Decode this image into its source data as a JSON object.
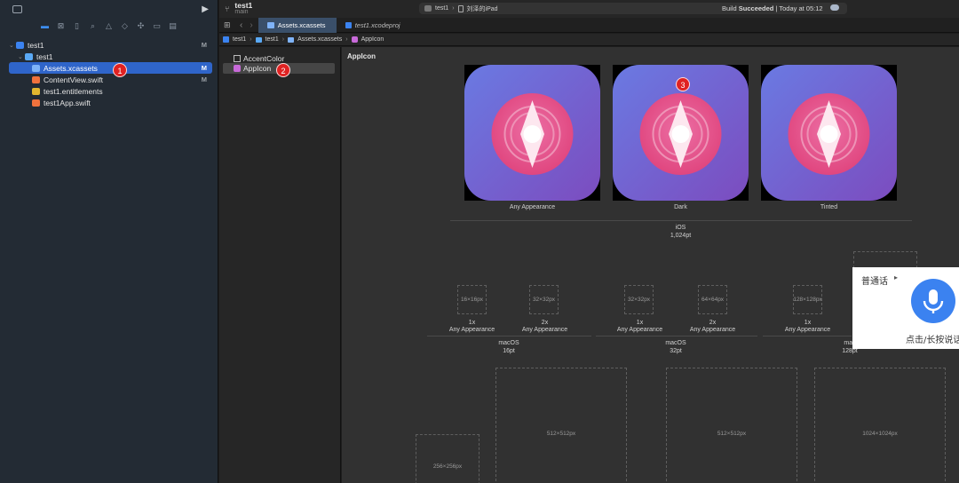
{
  "navigator": {
    "items": [
      {
        "label": "test1",
        "badge": "M"
      },
      {
        "label": "test1",
        "badge": ""
      },
      {
        "label": "Assets.xcassets",
        "badge": "M"
      },
      {
        "label": "ContentView.swift",
        "badge": "M"
      },
      {
        "label": "test1.entitlements",
        "badge": ""
      },
      {
        "label": "test1App.swift",
        "badge": ""
      }
    ]
  },
  "markers": [
    "1",
    "2",
    "3"
  ],
  "toolbar": {
    "scheme_name": "test1",
    "branch": "main",
    "destination_project": "test1",
    "destination_device": "刘泽的iPad",
    "build_prefix": "Build ",
    "build_status": "Succeeded",
    "build_time": " | Today at 05:12"
  },
  "tabs": [
    {
      "label": "Assets.xcassets"
    },
    {
      "label": "test1.xcodeproj"
    }
  ],
  "jumpbar": [
    "test1",
    "test1",
    "Assets.xcassets",
    "AppIcon"
  ],
  "assets": [
    {
      "label": "AccentColor"
    },
    {
      "label": "AppIcon"
    }
  ],
  "canvas": {
    "title": "AppIcon",
    "ios_appearances": [
      "Any Appearance",
      "Dark",
      "Tinted"
    ],
    "ios_group": {
      "platform": "iOS",
      "size": "1,024pt"
    },
    "mac_slots": [
      "16×16px",
      "32×32px",
      "32×32px",
      "64×64px",
      "128×128px"
    ],
    "mac_scales": [
      {
        "scale": "1x",
        "appearance": "Any Appearance"
      },
      {
        "scale": "2x",
        "appearance": "Any Appearance"
      },
      {
        "scale": "1x",
        "appearance": "Any Appearance"
      },
      {
        "scale": "2x",
        "appearance": "Any Appearance"
      },
      {
        "scale": "1x",
        "appearance": "Any Appearance"
      }
    ],
    "mac_groups": [
      {
        "platform": "macOS",
        "size": "16pt"
      },
      {
        "platform": "macOS",
        "size": "32pt"
      },
      {
        "platform": "mac",
        "size": "128pt"
      }
    ],
    "large_slots": [
      "256×256px",
      "512×512px",
      "512×512px",
      "1024×1024px"
    ]
  },
  "voice_popup": {
    "label": "普通话",
    "hint": "点击/长按说话"
  },
  "colors": {
    "selection": "#2f65ca",
    "icon_bg_top": "#6a79e0",
    "icon_bg_bottom": "#7a4fc0",
    "icon_circle": "#e8508c",
    "marker": "#e02222",
    "mic": "#3b82f0"
  }
}
